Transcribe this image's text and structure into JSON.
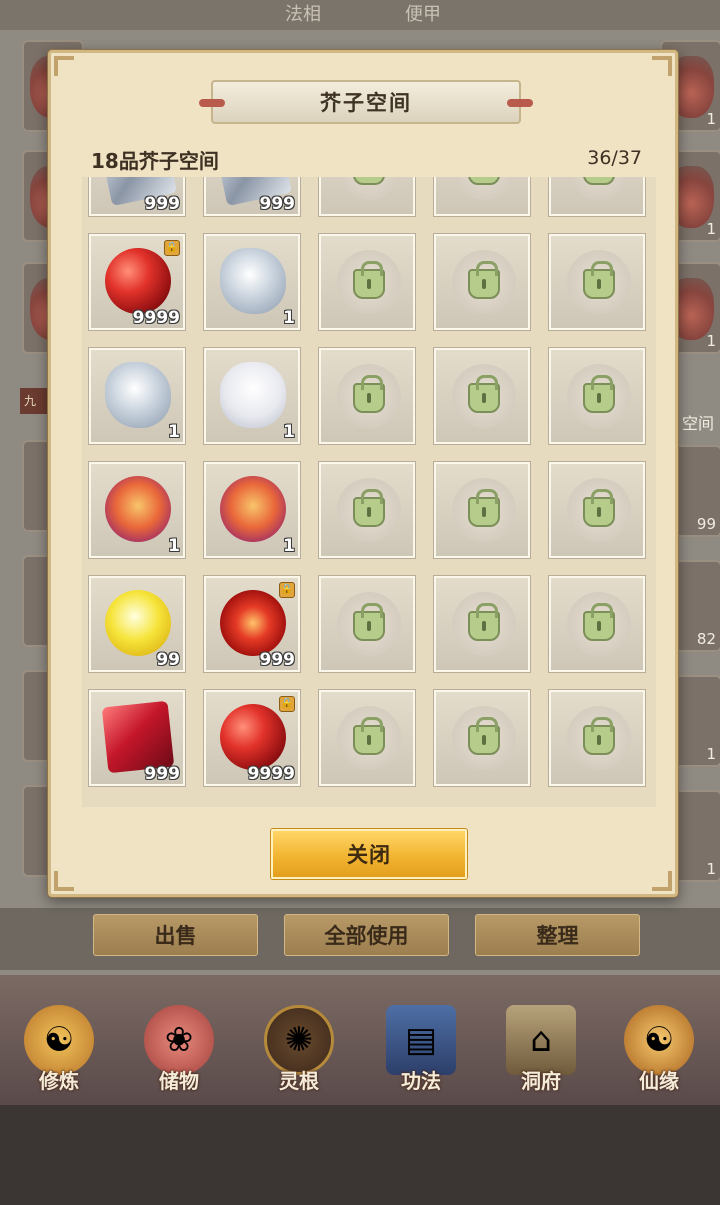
{
  "background": {
    "top_tabs": [
      "法相",
      "便甲"
    ],
    "side_slots_right": [
      {
        "count": "1"
      },
      {
        "count": "1"
      },
      {
        "count": "1"
      },
      {
        "count": "99"
      },
      {
        "count": "82"
      },
      {
        "count": "1"
      },
      {
        "count": "1"
      }
    ],
    "right_label": "空间",
    "left_tag": "九",
    "action_buttons": [
      "出售",
      "全部使用",
      "整理"
    ]
  },
  "nav": [
    {
      "label": "修炼",
      "icon": "cultivate-icon"
    },
    {
      "label": "储物",
      "icon": "storage-bag-icon"
    },
    {
      "label": "灵根",
      "icon": "spirit-root-icon"
    },
    {
      "label": "功法",
      "icon": "scripture-book-icon"
    },
    {
      "label": "洞府",
      "icon": "cave-mansion-icon"
    },
    {
      "label": "仙缘",
      "icon": "immortal-fate-icon"
    }
  ],
  "modal": {
    "title": "芥子空间",
    "subtitle": "18品芥子空间",
    "capacity": "36/37",
    "close_label": "关闭",
    "rows": [
      [
        {
          "item": "crystal",
          "count": "999",
          "locked": false
        },
        {
          "item": "crystal",
          "count": "999",
          "locked": false
        },
        {
          "item": null
        },
        {
          "item": null
        },
        {
          "item": null
        }
      ],
      [
        {
          "item": "red-orb",
          "count": "9999",
          "locked": true
        },
        {
          "item": "silver-dragon",
          "count": "1",
          "locked": false
        },
        {
          "item": null
        },
        {
          "item": null
        },
        {
          "item": null
        }
      ],
      [
        {
          "item": "silver-dragon",
          "count": "1",
          "locked": false
        },
        {
          "item": "white-beast",
          "count": "1",
          "locked": false
        },
        {
          "item": null
        },
        {
          "item": null
        },
        {
          "item": null
        }
      ],
      [
        {
          "item": "jewel-ring",
          "count": "1",
          "locked": false
        },
        {
          "item": "jewel-ring",
          "count": "1",
          "locked": false
        },
        {
          "item": null
        },
        {
          "item": null
        },
        {
          "item": null
        }
      ],
      [
        {
          "item": "yellow-orb",
          "count": "99",
          "locked": false
        },
        {
          "item": "fire-orb",
          "count": "999",
          "locked": true
        },
        {
          "item": null
        },
        {
          "item": null
        },
        {
          "item": null
        }
      ],
      [
        {
          "item": "red-gem",
          "count": "999",
          "locked": false
        },
        {
          "item": "red-orb",
          "count": "9999",
          "locked": true
        },
        {
          "item": null
        },
        {
          "item": null
        },
        {
          "item": null
        }
      ]
    ]
  }
}
